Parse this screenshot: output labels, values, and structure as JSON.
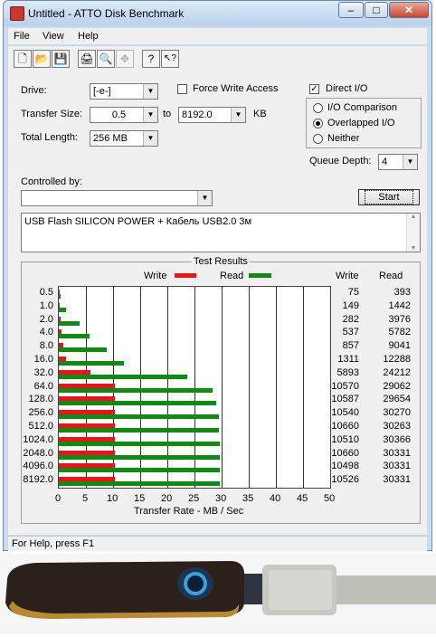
{
  "window": {
    "title": "Untitled - ATTO Disk Benchmark",
    "min": "–",
    "max": "□",
    "close": "✕"
  },
  "menu": [
    "File",
    "View",
    "Help"
  ],
  "toolbar": {
    "icons": [
      "new-icon",
      "open-icon",
      "save-icon",
      "print-icon",
      "print-preview-icon",
      "move-icon",
      "help-icon",
      "context-help-icon"
    ],
    "glyphs": [
      "🗋",
      "📂",
      "💾",
      "🖨",
      "🔍",
      "✥",
      "?",
      "↖?"
    ]
  },
  "form": {
    "drive_label": "Drive:",
    "drive_value": "[-e-]",
    "force_write_label": "Force Write Access",
    "direct_io_label": "Direct I/O",
    "direct_io_checked": true,
    "transfer_size_label": "Transfer Size:",
    "transfer_from": "0.5",
    "to_label": "to",
    "transfer_to": "8192.0",
    "kb_label": "KB",
    "total_length_label": "Total Length:",
    "total_length_value": "256 MB",
    "io_comparison_label": "I/O Comparison",
    "overlapped_io_label": "Overlapped I/O",
    "neither_label": "Neither",
    "queue_depth_label": "Queue Depth:",
    "queue_depth_value": "4",
    "controlled_by_label": "Controlled by:",
    "controlled_by_value": "",
    "start_label": "Start",
    "description": "USB Flash SILICON POWER + Кабель USB2.0 3м"
  },
  "chart_data": {
    "type": "bar",
    "title": "Test Results",
    "xlabel": "Transfer Rate - MB / Sec",
    "xlim": [
      0,
      50
    ],
    "xticks": [
      "0",
      "5",
      "10",
      "15",
      "20",
      "25",
      "30",
      "35",
      "40",
      "45",
      "50"
    ],
    "categories": [
      "0.5",
      "1.0",
      "2.0",
      "4.0",
      "8.0",
      "16.0",
      "32.0",
      "64.0",
      "128.0",
      "256.0",
      "512.0",
      "1024.0",
      "2048.0",
      "4096.0",
      "8192.0"
    ],
    "series": [
      {
        "name": "Write",
        "color": "#e8151a",
        "values_kb": [
          75,
          149,
          282,
          537,
          857,
          1311,
          5893,
          10570,
          10587,
          10540,
          10660,
          10510,
          10660,
          10498,
          10526
        ]
      },
      {
        "name": "Read",
        "color": "#0f8a15",
        "values_kb": [
          393,
          1442,
          3976,
          5782,
          9041,
          12288,
          24212,
          29062,
          29654,
          30270,
          30263,
          30366,
          30331,
          30331,
          30331
        ]
      }
    ],
    "table_headers": [
      "Write",
      "Read"
    ]
  },
  "status": "For Help, press F1"
}
